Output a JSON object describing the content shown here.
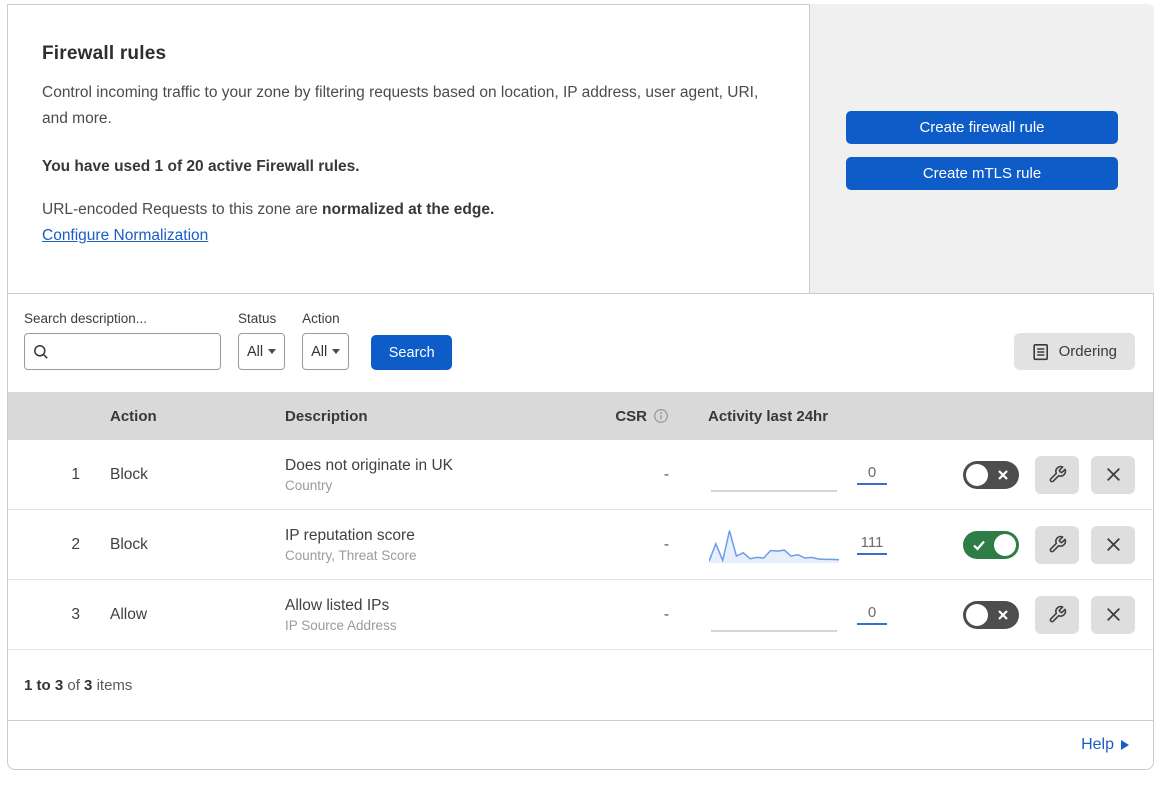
{
  "colors": {
    "accent_blue": "#0d5cc8",
    "link_blue": "#1a5cc8",
    "toggle_on_green": "#2e7d46",
    "toggle_off_gray": "#4d4d4d",
    "sparkline_blue": "#6d9ceb",
    "table_header_gray": "#d9d9d9",
    "panel_gray": "#f0f0f0"
  },
  "header": {
    "title": "Firewall rules",
    "description": "Control incoming traffic to your zone by filtering requests based on location, IP address, user agent, URI, and more.",
    "usage_bold": "You have used 1 of 20 active Firewall rules.",
    "normalization_prefix": "URL-encoded Requests to this zone are ",
    "normalization_bold": "normalized at the edge.",
    "normalization_link": "Configure Normalization",
    "create_firewall_button": "Create firewall rule",
    "create_mtls_button": "Create mTLS rule"
  },
  "filters": {
    "search_label": "Search description...",
    "status_label": "Status",
    "status_value": "All",
    "action_label": "Action",
    "action_value": "All",
    "search_button": "Search",
    "ordering_button": "Ordering"
  },
  "table": {
    "columns": {
      "action": "Action",
      "description": "Description",
      "csr": "CSR",
      "activity": "Activity last 24hr"
    },
    "rows": [
      {
        "priority": "1",
        "action": "Block",
        "description": "Does not originate in UK",
        "fields": "Country",
        "csr": "-",
        "activity_count": "0",
        "enabled": false,
        "sparkline": []
      },
      {
        "priority": "2",
        "action": "Block",
        "description": "IP reputation score",
        "fields": "Country, Threat Score",
        "csr": "-",
        "activity_count": "111",
        "enabled": true,
        "sparkline": [
          2,
          55,
          5,
          95,
          18,
          28,
          10,
          14,
          12,
          35,
          33,
          36,
          18,
          22,
          12,
          14,
          9,
          8,
          8,
          7
        ]
      },
      {
        "priority": "3",
        "action": "Allow",
        "description": "Allow listed IPs",
        "fields": "IP Source Address",
        "csr": "-",
        "activity_count": "0",
        "enabled": false,
        "sparkline": []
      }
    ]
  },
  "footer": {
    "range_bold": "1 to 3",
    "of_text": "of",
    "total_bold": "3",
    "items_text": "items",
    "help_label": "Help"
  }
}
